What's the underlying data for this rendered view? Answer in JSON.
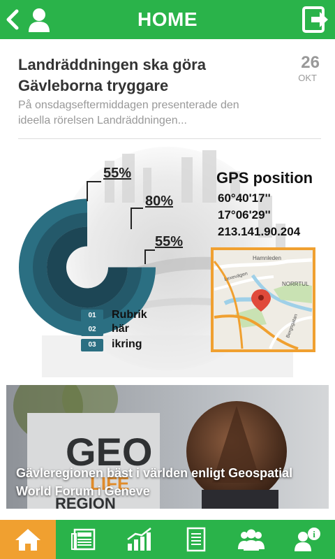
{
  "header": {
    "title": "HOME"
  },
  "news": {
    "headline": "Landräddningen ska göra Gävleborna tryggare",
    "day": "26",
    "month": "OKT",
    "summary": "På onsdagseftermiddagen presenterade den ideella rörelsen Landräddningen..."
  },
  "infographic": {
    "percent_outer": "55%",
    "percent_middle": "80%",
    "percent_inner": "55%",
    "legend": [
      {
        "num": "01",
        "label": "Rubrik"
      },
      {
        "num": "02",
        "label": "här"
      },
      {
        "num": "03",
        "label": "ikring"
      }
    ],
    "gps": {
      "title": "GPS position",
      "lat": "60°40'17''",
      "lon": "17°06'29''",
      "ip": "213.141.90.204"
    },
    "map_labels": {
      "road1": "Hamnleden",
      "road2": "Lexevägen",
      "district": "NORRTUL",
      "road3": "Bergsgatan"
    }
  },
  "banner": {
    "caption": "Gävleregionen bäst i världen enligt Geospatial World Forum i Geneve",
    "sign_text": "GEO",
    "sign_text_2": "LIFE",
    "sign_text_3": "REGION"
  },
  "tabs": [
    {
      "name": "home",
      "active": true
    },
    {
      "name": "news"
    },
    {
      "name": "stats"
    },
    {
      "name": "documents"
    },
    {
      "name": "people"
    },
    {
      "name": "info"
    }
  ],
  "colors": {
    "green": "#2ab34a",
    "orange": "#f0a030",
    "ring1": "#2b6f82",
    "ring2": "#24596a",
    "ring3": "#1d4655"
  }
}
